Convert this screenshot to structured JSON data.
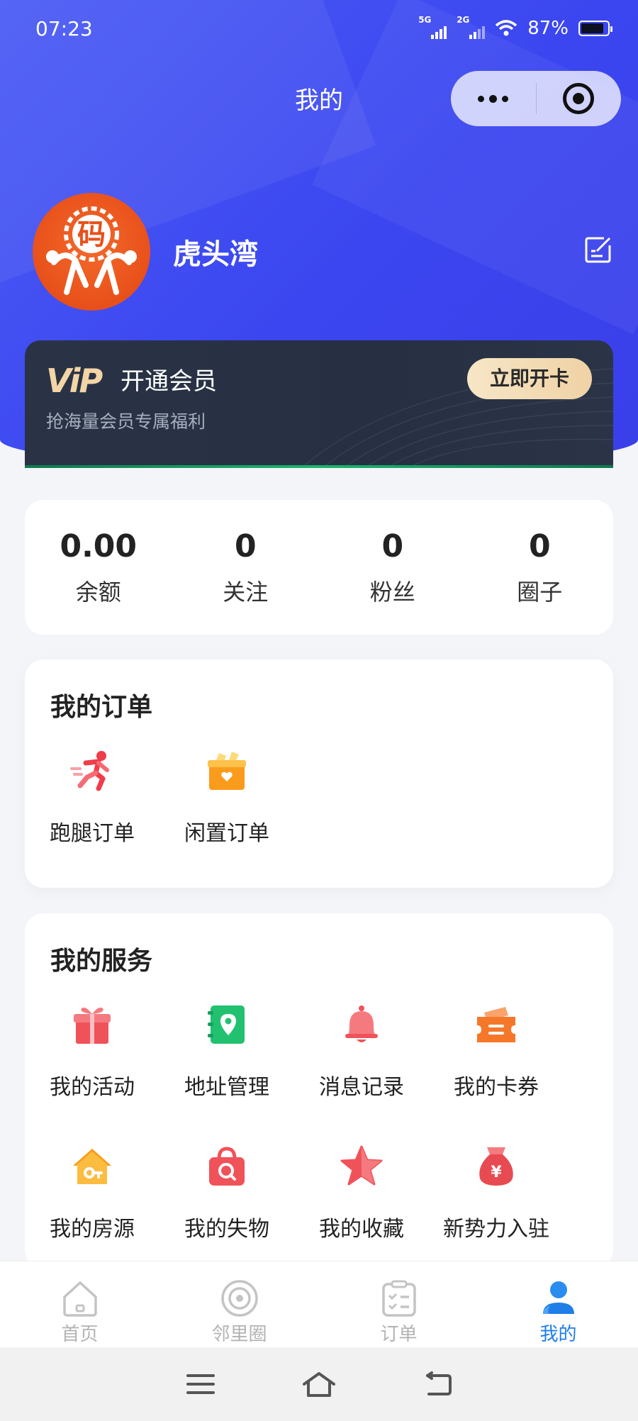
{
  "status": {
    "time": "07:23",
    "net1": "5G",
    "net2": "2G",
    "battery": "87%"
  },
  "nav": {
    "title": "我的"
  },
  "profile": {
    "name": "虎头湾",
    "avatar_text": "码"
  },
  "vip": {
    "logo": "ViP",
    "title": "开通会员",
    "subtitle": "抢海量会员专属福利",
    "button": "立即开卡"
  },
  "stats": [
    {
      "value": "0.00",
      "label": "余额"
    },
    {
      "value": "0",
      "label": "关注"
    },
    {
      "value": "0",
      "label": "粉丝"
    },
    {
      "value": "0",
      "label": "圈子"
    }
  ],
  "orders": {
    "title": "我的订单",
    "items": [
      {
        "label": "跑腿订单",
        "icon": "runner-icon"
      },
      {
        "label": "闲置订单",
        "icon": "box-icon"
      }
    ]
  },
  "services": {
    "title": "我的服务",
    "items": [
      {
        "label": "我的活动",
        "icon": "gift-icon"
      },
      {
        "label": "地址管理",
        "icon": "address-book-icon"
      },
      {
        "label": "消息记录",
        "icon": "bell-icon"
      },
      {
        "label": "我的卡券",
        "icon": "coupon-icon"
      },
      {
        "label": "我的房源",
        "icon": "house-icon"
      },
      {
        "label": "我的失物",
        "icon": "lost-bag-icon"
      },
      {
        "label": "我的收藏",
        "icon": "star-icon"
      },
      {
        "label": "新势力入驻",
        "icon": "money-bag-icon"
      }
    ]
  },
  "tabbar": [
    {
      "label": "首页",
      "icon": "home-icon",
      "active": false
    },
    {
      "label": "邻里圈",
      "icon": "circle-icon",
      "active": false
    },
    {
      "label": "订单",
      "icon": "clipboard-icon",
      "active": false
    },
    {
      "label": "我的",
      "icon": "user-icon",
      "active": true
    }
  ],
  "colors": {
    "primary": "#3b46f0",
    "tab_active": "#1f7ee8",
    "vip_gold": "#f3d5a6",
    "vip_bg": "#263042"
  }
}
